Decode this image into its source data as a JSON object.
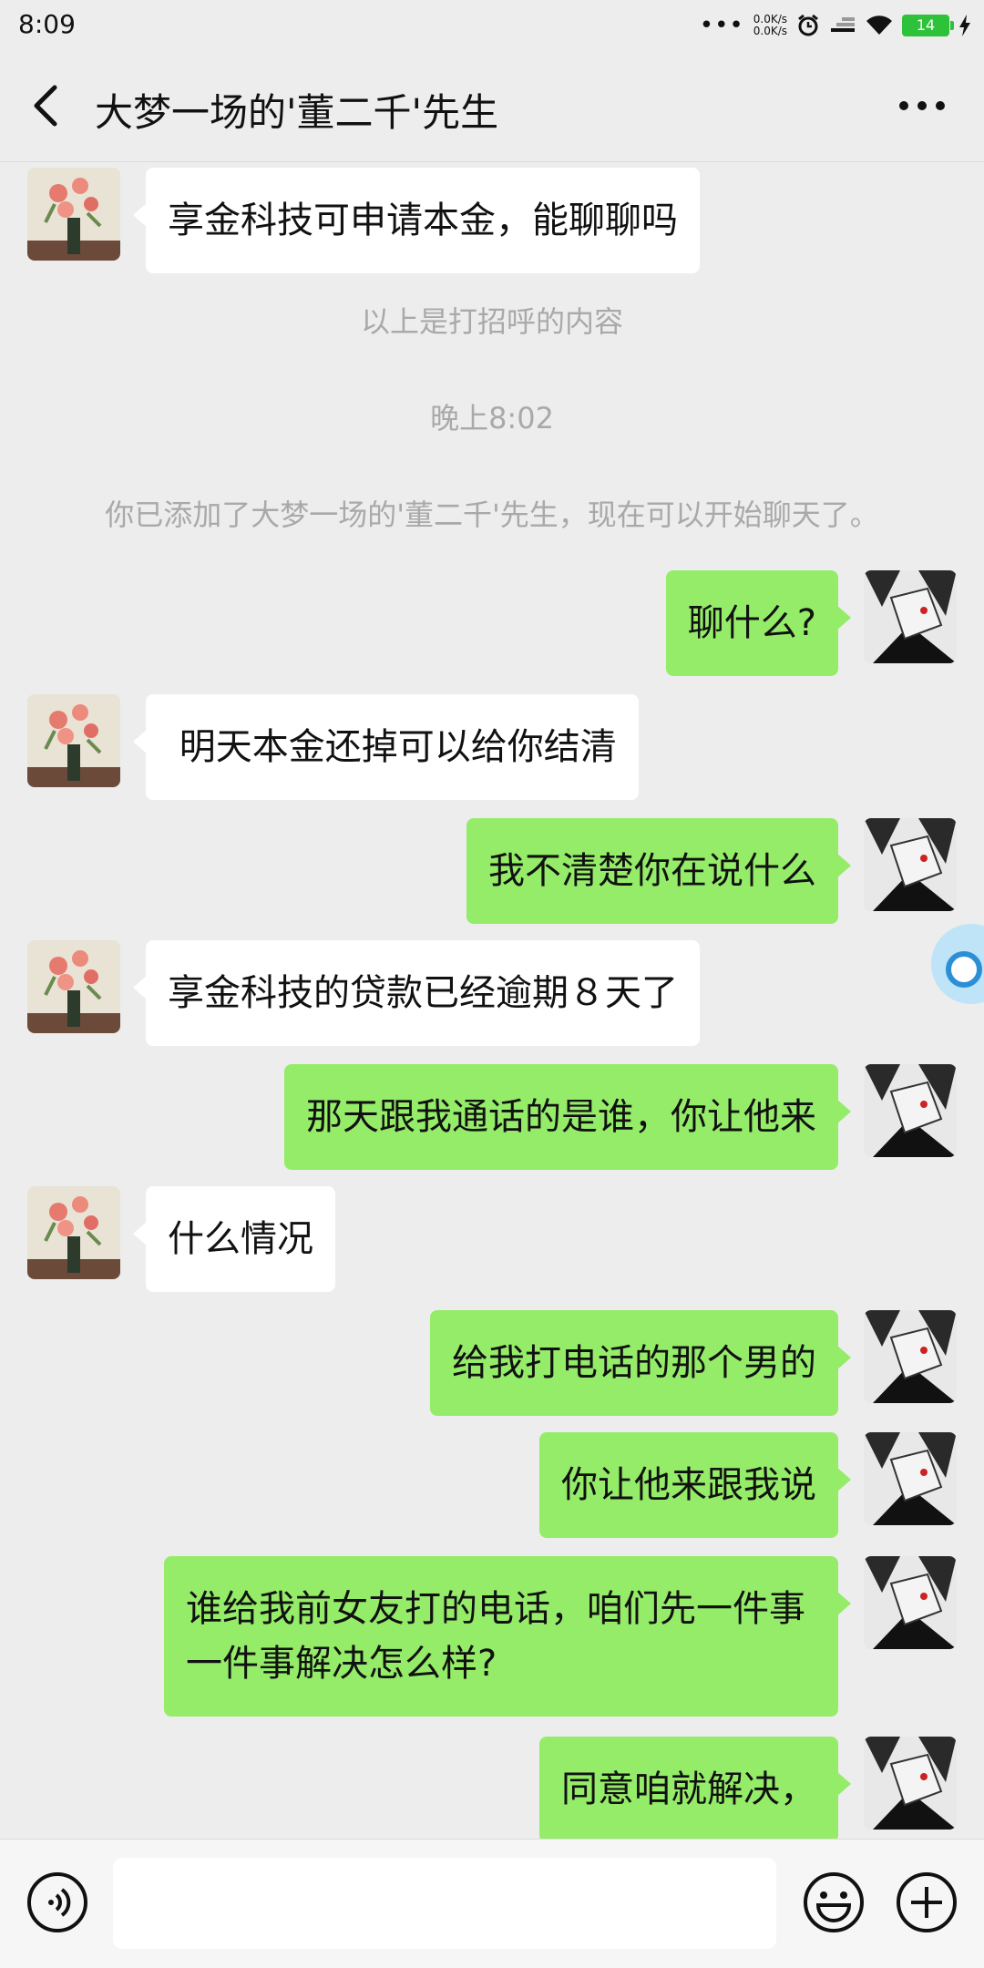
{
  "status_bar": {
    "time": "8:09",
    "net_speed_up": "0.0K/s",
    "net_speed_down": "0.0K/s",
    "battery": "14"
  },
  "header": {
    "title": "大梦一场的'董二千'先生",
    "back_icon": "chevron-left-icon",
    "more_icon": "more-horizontal-icon"
  },
  "colors": {
    "background": "#ededed",
    "outgoing_bubble": "#95ec69",
    "incoming_bubble": "#ffffff",
    "system_text": "#a9a9a9"
  },
  "messages": [
    {
      "side": "in",
      "text": "享金科技可申请本金，能聊聊吗"
    },
    {
      "type": "system",
      "text": "以上是打招呼的内容"
    },
    {
      "type": "system",
      "text": "晚上8:02"
    },
    {
      "type": "system",
      "text": "你已添加了大梦一场的'董二千'先生，现在可以开始聊天了。"
    },
    {
      "side": "out",
      "text": "聊什么?"
    },
    {
      "side": "in",
      "text": " 明天本金还掉可以给你结清"
    },
    {
      "side": "out",
      "text": "我不清楚你在说什么"
    },
    {
      "side": "in",
      "text": "享金科技的贷款已经逾期８天了"
    },
    {
      "side": "out",
      "text": "那天跟我通话的是谁，你让他来"
    },
    {
      "side": "in",
      "text": "什么情况"
    },
    {
      "side": "out",
      "text": "给我打电话的那个男的"
    },
    {
      "side": "out",
      "text": "你让他来跟我说"
    },
    {
      "side": "out",
      "text": "谁给我前女友打的电话，咱们先一件事一件事解决怎么样?"
    },
    {
      "side": "out",
      "text": "同意咱就解决，"
    }
  ],
  "input_bar": {
    "placeholder": "",
    "voice_icon": "voice-icon",
    "emoji_icon": "emoji-icon",
    "plus_icon": "plus-circle-icon"
  }
}
